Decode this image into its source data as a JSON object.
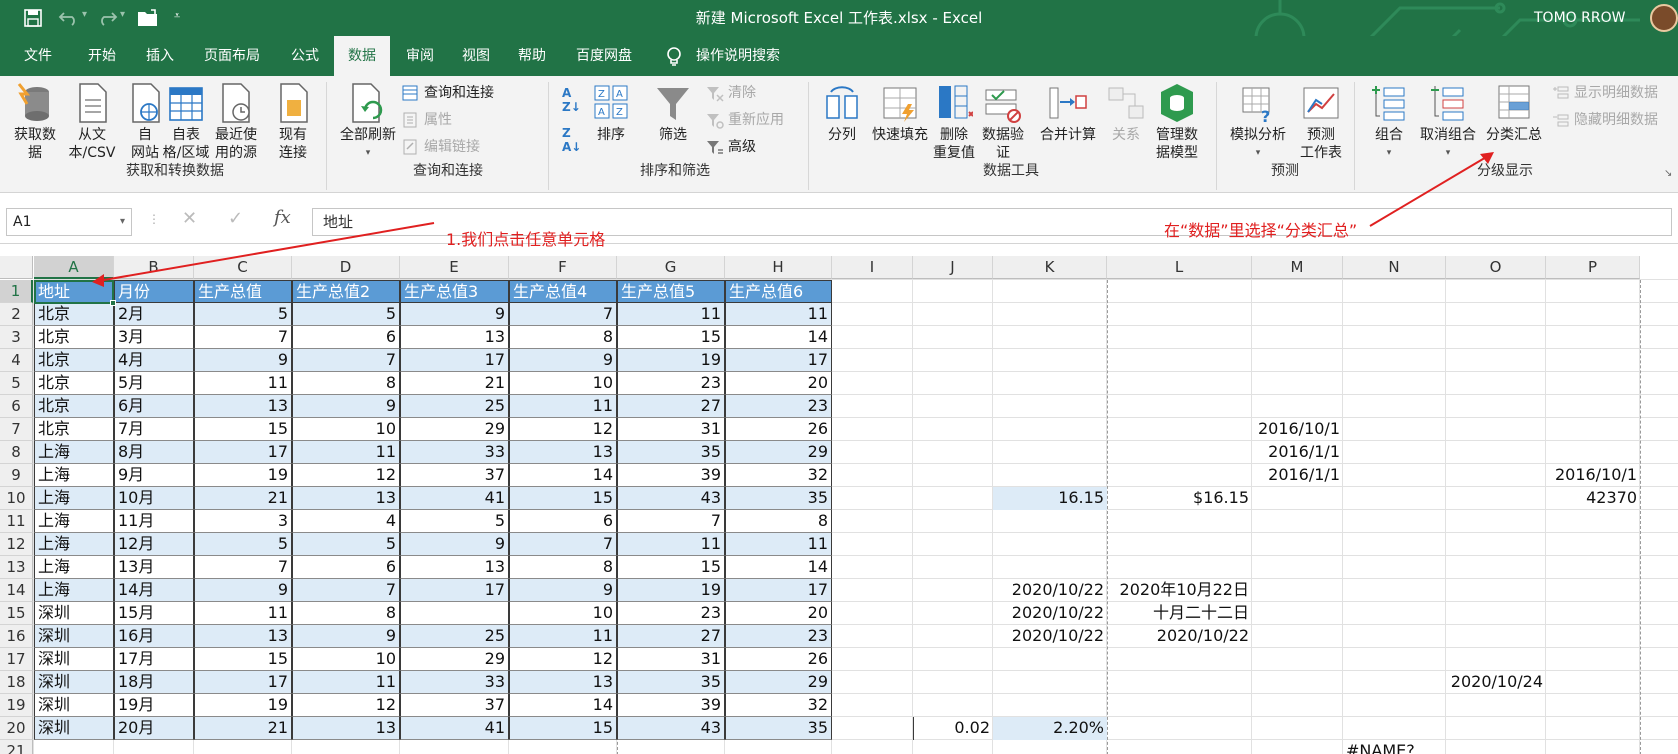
{
  "titlebar": {
    "title": "新建 Microsoft Excel 工作表.xlsx  -  Excel",
    "user": "TOMO RROW"
  },
  "tabs": [
    "文件",
    "开始",
    "插入",
    "页面布局",
    "公式",
    "数据",
    "审阅",
    "视图",
    "帮助",
    "百度网盘"
  ],
  "active_tab": "数据",
  "tell_me": "操作说明搜索",
  "ribbon": {
    "get_data": "获取数\n据",
    "from_csv": "从文\n本/CSV",
    "from_web": "自\n网站",
    "from_table": "自表\n格/区域",
    "recent_sources": "最近使\n用的源",
    "existing_conn": "现有\n连接",
    "group_get": "获取和转换数据",
    "refresh_all": "全部刷新",
    "queries_conn": "查询和连接",
    "properties": "属性",
    "edit_links": "编辑链接",
    "group_queries": "查询和连接",
    "sort": "排序",
    "filter": "筛选",
    "clear": "清除",
    "reapply": "重新应用",
    "advanced": "高级",
    "group_sort": "排序和筛选",
    "split": "分列",
    "flash_fill": "快速填充",
    "remove_dup": "删除\n重复值",
    "validation": "数据验\n证",
    "consolidate": "合并计算",
    "relations": "关系",
    "data_model": "管理数\n据模型",
    "group_tools": "数据工具",
    "what_if": "模拟分析",
    "forecast": "预测\n工作表",
    "group_forecast": "预测",
    "group_btn": "组合",
    "ungroup": "取消组合",
    "subtotal": "分类汇总",
    "show_detail": "显示明细数据",
    "hide_detail": "隐藏明细数据",
    "group_outline": "分级显示"
  },
  "namebox": "A1",
  "formula": "地址",
  "annotations": {
    "step1": "1.我们点击任意单元格",
    "step2": "在“数据”里选择“分类汇总”"
  },
  "columns": [
    "A",
    "B",
    "C",
    "D",
    "E",
    "F",
    "G",
    "H",
    "I",
    "J",
    "K",
    "L",
    "M",
    "N",
    "O",
    "P"
  ],
  "rows": [
    "1",
    "2",
    "3",
    "4",
    "5",
    "6",
    "7",
    "8",
    "9",
    "10",
    "11",
    "12",
    "13",
    "14",
    "15",
    "16",
    "17",
    "18",
    "19",
    "20",
    "21"
  ],
  "table": {
    "headers": [
      "地址",
      "月份",
      "生产总值",
      "生产总值2",
      "生产总值3",
      "生产总值4",
      "生产总值5",
      "生产总值6"
    ],
    "data": [
      [
        "北京",
        "2月",
        "5",
        "5",
        "9",
        "7",
        "11",
        "11"
      ],
      [
        "北京",
        "3月",
        "7",
        "6",
        "13",
        "8",
        "15",
        "14"
      ],
      [
        "北京",
        "4月",
        "9",
        "7",
        "17",
        "9",
        "19",
        "17"
      ],
      [
        "北京",
        "5月",
        "11",
        "8",
        "21",
        "10",
        "23",
        "20"
      ],
      [
        "北京",
        "6月",
        "13",
        "9",
        "25",
        "11",
        "27",
        "23"
      ],
      [
        "北京",
        "7月",
        "15",
        "10",
        "29",
        "12",
        "31",
        "26"
      ],
      [
        "上海",
        "8月",
        "17",
        "11",
        "33",
        "13",
        "35",
        "29"
      ],
      [
        "上海",
        "9月",
        "19",
        "12",
        "37",
        "14",
        "39",
        "32"
      ],
      [
        "上海",
        "10月",
        "21",
        "13",
        "41",
        "15",
        "43",
        "35"
      ],
      [
        "上海",
        "11月",
        "3",
        "4",
        "5",
        "6",
        "7",
        "8"
      ],
      [
        "上海",
        "12月",
        "5",
        "5",
        "9",
        "7",
        "11",
        "11"
      ],
      [
        "上海",
        "13月",
        "7",
        "6",
        "13",
        "8",
        "15",
        "14"
      ],
      [
        "上海",
        "14月",
        "9",
        "7",
        "17",
        "9",
        "19",
        "17"
      ],
      [
        "深圳",
        "15月",
        "11",
        "8",
        "",
        "10",
        "23",
        "20"
      ],
      [
        "深圳",
        "16月",
        "13",
        "9",
        "25",
        "11",
        "27",
        "23"
      ],
      [
        "深圳",
        "17月",
        "15",
        "10",
        "29",
        "12",
        "31",
        "26"
      ],
      [
        "深圳",
        "18月",
        "17",
        "11",
        "33",
        "13",
        "35",
        "29"
      ],
      [
        "深圳",
        "19月",
        "19",
        "12",
        "37",
        "14",
        "39",
        "32"
      ],
      [
        "深圳",
        "20月",
        "21",
        "13",
        "41",
        "15",
        "43",
        "35"
      ]
    ]
  },
  "extra_cells": {
    "M7": "2016/10/1",
    "M8": "2016/1/1",
    "M9": "2016/1/1",
    "P9": "2016/10/1",
    "K10": "16.15",
    "L10": "$16.15",
    "P10": "42370",
    "K14": "2020/10/22",
    "L14": "2020年10月22日",
    "K15": "2020/10/22",
    "L15": "十月二十二日",
    "K16": "2020/10/22",
    "L16": "2020/10/22",
    "O18": "2020/10/24",
    "J20": "0.02",
    "K20": "2.20%",
    "N21": "#NAME?"
  },
  "colors": {
    "excel_green": "#217346",
    "header_blue": "#5b9bd5",
    "band_blue": "#ddebf7",
    "annotation_red": "#e02020"
  }
}
